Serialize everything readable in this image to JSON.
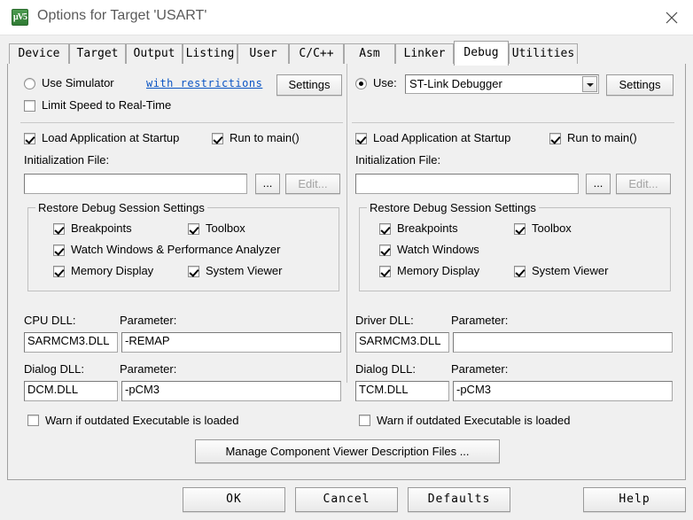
{
  "window": {
    "title": "Options for Target 'USART'",
    "icon": "keil-uvision-logo",
    "close_icon": "close-icon"
  },
  "tabs": [
    {
      "label": "Device",
      "active": false
    },
    {
      "label": "Target",
      "active": false
    },
    {
      "label": "Output",
      "active": false
    },
    {
      "label": "Listing",
      "active": false
    },
    {
      "label": "User",
      "active": false
    },
    {
      "label": "C/C++",
      "active": false
    },
    {
      "label": "Asm",
      "active": false
    },
    {
      "label": "Linker",
      "active": false
    },
    {
      "label": "Debug",
      "active": true
    },
    {
      "label": "Utilities",
      "active": false
    }
  ],
  "left_panel": {
    "use_simulator": {
      "label": "Use Simulator",
      "selected": false,
      "link_label": "with restrictions",
      "settings_label": "Settings"
    },
    "limit_speed": {
      "label": "Limit Speed to Real-Time",
      "checked": false
    },
    "load_app": {
      "label": "Load Application at Startup",
      "checked": true
    },
    "run_to_main": {
      "label": "Run to main()",
      "checked": true
    },
    "init_file": {
      "label": "Initialization File:",
      "value": "",
      "browse_label": "...",
      "edit_label": "Edit...",
      "edit_disabled": true
    },
    "restore_group": {
      "title": "Restore Debug Session Settings",
      "items": [
        {
          "label": "Breakpoints",
          "checked": true
        },
        {
          "label": "Toolbox",
          "checked": true
        },
        {
          "label": "Watch Windows & Performance Analyzer",
          "checked": true
        },
        {
          "label": "Memory Display",
          "checked": true
        },
        {
          "label": "System Viewer",
          "checked": true
        }
      ]
    },
    "cpu_dll": {
      "label": "CPU DLL:",
      "value": "SARMCM3.DLL"
    },
    "cpu_param": {
      "label": "Parameter:",
      "value": "-REMAP"
    },
    "dialog_dll": {
      "label": "Dialog DLL:",
      "value": "DCM.DLL"
    },
    "dialog_param": {
      "label": "Parameter:",
      "value": "-pCM3"
    },
    "warn_outdated": {
      "label": "Warn if outdated Executable is loaded",
      "checked": false
    }
  },
  "right_panel": {
    "use_debugger": {
      "label": "Use:",
      "selected": true,
      "value": "ST-Link Debugger",
      "settings_label": "Settings"
    },
    "load_app": {
      "label": "Load Application at Startup",
      "checked": true
    },
    "run_to_main": {
      "label": "Run to main()",
      "checked": true
    },
    "init_file": {
      "label": "Initialization File:",
      "value": "",
      "browse_label": "...",
      "edit_label": "Edit...",
      "edit_disabled": true
    },
    "restore_group": {
      "title": "Restore Debug Session Settings",
      "items": [
        {
          "label": "Breakpoints",
          "checked": true
        },
        {
          "label": "Toolbox",
          "checked": true
        },
        {
          "label": "Watch Windows",
          "checked": true
        },
        {
          "label": "Memory Display",
          "checked": true
        },
        {
          "label": "System Viewer",
          "checked": true
        }
      ]
    },
    "driver_dll": {
      "label": "Driver DLL:",
      "value": "SARMCM3.DLL"
    },
    "driver_param": {
      "label": "Parameter:",
      "value": ""
    },
    "dialog_dll": {
      "label": "Dialog DLL:",
      "value": "TCM.DLL"
    },
    "dialog_param": {
      "label": "Parameter:",
      "value": "-pCM3"
    },
    "warn_outdated": {
      "label": "Warn if outdated Executable is loaded",
      "checked": false
    }
  },
  "manage_button": {
    "label": "Manage Component Viewer Description Files ..."
  },
  "footer": {
    "ok": "OK",
    "cancel": "Cancel",
    "defaults": "Defaults",
    "help": "Help"
  },
  "colors": {
    "dialog_bg": "#f0f0f0",
    "titlebar_bg": "#ffffff",
    "link": "#0b55c4",
    "logo_green": "#3d8a41",
    "field_bg": "#ffffff",
    "border": "#a0a0a0"
  }
}
